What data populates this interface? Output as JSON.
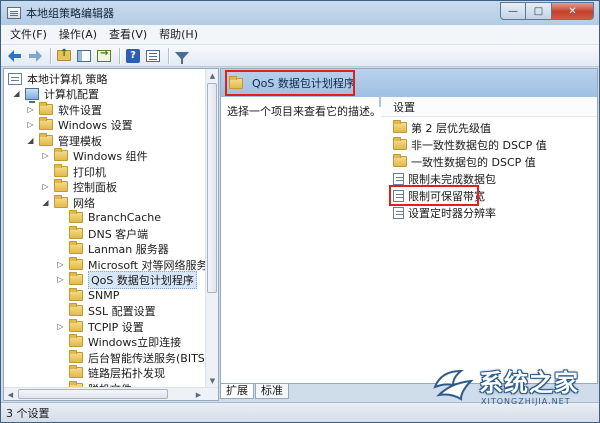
{
  "window": {
    "title": "本地组策略编辑器",
    "controls": {
      "minimize": "—",
      "maximize": "□",
      "close": "✕"
    }
  },
  "menubar": {
    "items": [
      "文件(F)",
      "操作(A)",
      "查看(V)",
      "帮助(H)"
    ]
  },
  "toolbar": {
    "icons": [
      "back-icon",
      "forward-icon",
      "up-folder-icon",
      "show-hide-tree-icon",
      "export-list-icon",
      "help-icon",
      "view-icon",
      "filter-icon"
    ]
  },
  "tree": {
    "items": [
      {
        "label": "本地计算机 策略",
        "toggle": "",
        "icon": "policy-icon"
      },
      {
        "label": "计算机配置",
        "toggle": "◢",
        "icon": "computer-icon"
      },
      {
        "label": "软件设置",
        "toggle": "▷",
        "icon": "folder-icon"
      },
      {
        "label": "Windows 设置",
        "toggle": "▷",
        "icon": "folder-icon"
      },
      {
        "label": "管理模板",
        "toggle": "◢",
        "icon": "folder-icon"
      },
      {
        "label": "Windows 组件",
        "toggle": "▷",
        "icon": "folder-icon"
      },
      {
        "label": "打印机",
        "toggle": "",
        "icon": "folder-icon"
      },
      {
        "label": "控制面板",
        "toggle": "▷",
        "icon": "folder-icon"
      },
      {
        "label": "网络",
        "toggle": "◢",
        "icon": "folder-icon"
      },
      {
        "label": "BranchCache",
        "toggle": "",
        "icon": "folder-icon"
      },
      {
        "label": "DNS 客户端",
        "toggle": "",
        "icon": "folder-icon"
      },
      {
        "label": "Lanman 服务器",
        "toggle": "",
        "icon": "folder-icon"
      },
      {
        "label": "Microsoft 对等网络服务",
        "toggle": "▷",
        "icon": "folder-icon"
      },
      {
        "label": "QoS 数据包计划程序",
        "toggle": "▷",
        "icon": "folder-icon"
      },
      {
        "label": "SNMP",
        "toggle": "",
        "icon": "folder-icon"
      },
      {
        "label": "SSL 配置设置",
        "toggle": "",
        "icon": "folder-icon"
      },
      {
        "label": "TCPIP 设置",
        "toggle": "▷",
        "icon": "folder-icon"
      },
      {
        "label": "Windows立即连接",
        "toggle": "",
        "icon": "folder-icon"
      },
      {
        "label": "后台智能传送服务(BITS)",
        "toggle": "",
        "icon": "folder-icon"
      },
      {
        "label": "链路层拓扑发现",
        "toggle": "",
        "icon": "folder-icon"
      },
      {
        "label": "脱机文件",
        "toggle": "",
        "icon": "folder-icon"
      }
    ]
  },
  "right_pane": {
    "header_title": "QoS 数据包计划程序",
    "description_prompt": "选择一个项目来查看它的描述。",
    "settings_column_header": "设置",
    "settings": [
      {
        "label": "第 2 层优先级值",
        "icon": "folder-icon"
      },
      {
        "label": "非一致性数据包的 DSCP 值",
        "icon": "folder-icon"
      },
      {
        "label": "一致性数据包的 DSCP 值",
        "icon": "folder-icon"
      },
      {
        "label": "限制未完成数据包",
        "icon": "policy-icon"
      },
      {
        "label": "限制可保留带宽",
        "icon": "policy-icon"
      },
      {
        "label": "设置定时器分辨率",
        "icon": "policy-icon"
      }
    ]
  },
  "tabs": [
    "扩展",
    "标准"
  ],
  "statusbar": {
    "text": "3 个设置"
  },
  "watermark": {
    "text": "系统之家",
    "subtext": "XITONGZHIJIA.NET"
  },
  "colors": {
    "highlight": "#e0201a",
    "header_blue": "#a7c4e3",
    "selection": "#d7e6f7"
  }
}
